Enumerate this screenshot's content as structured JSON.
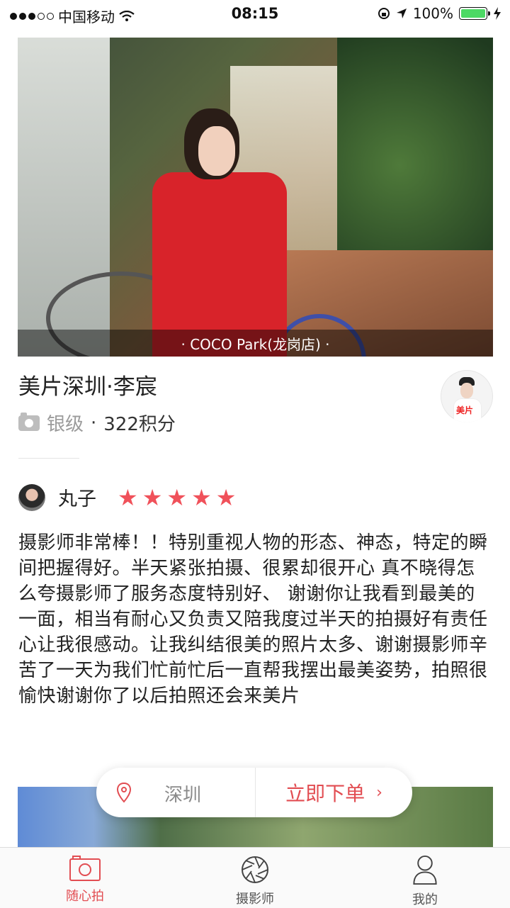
{
  "status_bar": {
    "carrier": "中国移动",
    "time": "08:15",
    "battery_text": "100%",
    "battery_level": 1.0,
    "battery_color": "#4cd964"
  },
  "hero": {
    "caption": "· COCO Park(龙岗店) ·"
  },
  "photographer": {
    "name": "美片深圳·李宸",
    "level": "银级",
    "separator": "·",
    "points": "322积分",
    "avatar_logo": "美片"
  },
  "review": {
    "reviewer_name": "丸子",
    "rating": 5,
    "rating_max": 5,
    "star_char": "★",
    "text": "摄影师非常棒！！特别重视人物的形态、神态，特定的瞬间把握得好。半天紧张拍摄、很累却很开心 真不晓得怎么夸摄影师了服务态度特别好、 谢谢你让我看到最美的一面，相当有耐心又负责又陪我度过半天的拍摄好有责任心让我很感动。让我纠结很美的照片太多、谢谢摄影师辛苦了一天为我们忙前忙后一直帮我摆出最美姿势，拍照很愉快谢谢你了以后拍照还会来美片"
  },
  "order_bar": {
    "location": "深圳",
    "order_label": "立即下单",
    "chevron": "›",
    "accent_color": "#e24d52"
  },
  "tabs": [
    {
      "label": "随心拍",
      "icon": "camera-icon",
      "active": true
    },
    {
      "label": "摄影师",
      "icon": "aperture-icon",
      "active": false
    },
    {
      "label": "我的",
      "icon": "user-icon",
      "active": false
    }
  ]
}
